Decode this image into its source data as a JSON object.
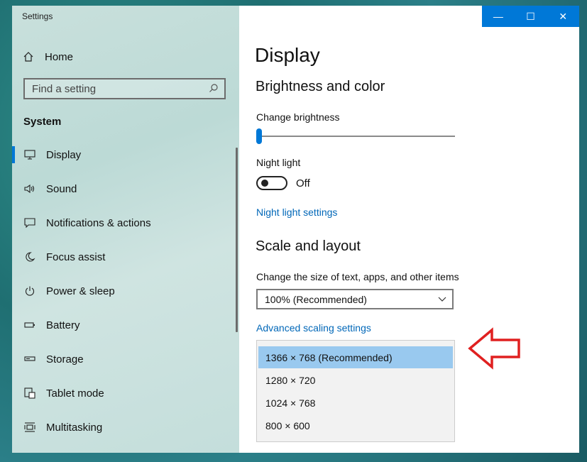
{
  "window": {
    "title": "Settings"
  },
  "titlebar": {
    "minimize": "—",
    "maximize": "☐",
    "close": "✕"
  },
  "sidebar": {
    "home": "Home",
    "search_placeholder": "Find a setting",
    "section": "System",
    "items": [
      {
        "label": "Display",
        "icon": "monitor-icon",
        "active": true
      },
      {
        "label": "Sound",
        "icon": "speaker-icon"
      },
      {
        "label": "Notifications & actions",
        "icon": "notification-icon"
      },
      {
        "label": "Focus assist",
        "icon": "moon-icon"
      },
      {
        "label": "Power & sleep",
        "icon": "power-icon"
      },
      {
        "label": "Battery",
        "icon": "battery-icon"
      },
      {
        "label": "Storage",
        "icon": "storage-icon"
      },
      {
        "label": "Tablet mode",
        "icon": "tablet-icon"
      },
      {
        "label": "Multitasking",
        "icon": "multitasking-icon"
      }
    ]
  },
  "main": {
    "page_title": "Display",
    "brightness_section": "Brightness and color",
    "change_brightness": "Change brightness",
    "brightness_level": 0,
    "night_light_label": "Night light",
    "night_light_state": "Off",
    "night_light_settings": "Night light settings",
    "scale_section": "Scale and layout",
    "scale_label": "Change the size of text, apps, and other items",
    "scale_value": "100% (Recommended)",
    "advanced_scaling": "Advanced scaling settings",
    "resolution_options": [
      "1366 × 768 (Recommended)",
      "1280 × 720",
      "1024 × 768",
      "800 × 600"
    ],
    "selected_resolution_index": 0
  },
  "colors": {
    "accent": "#0078d7",
    "link": "#0067b8",
    "annotation_arrow": "#e02020"
  }
}
